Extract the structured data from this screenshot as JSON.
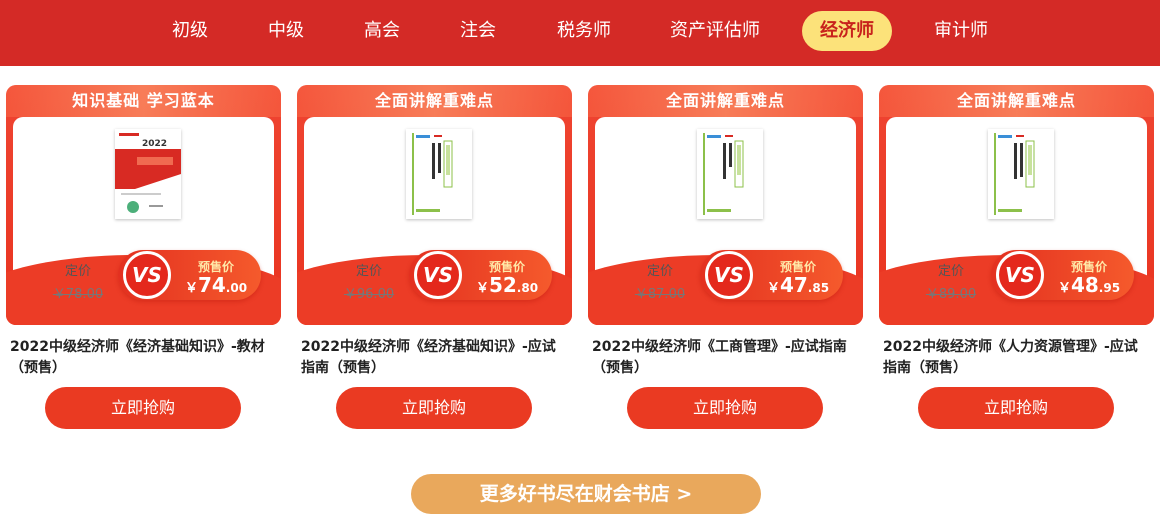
{
  "nav": {
    "tabs": [
      {
        "label": "初级"
      },
      {
        "label": "中级"
      },
      {
        "label": "高会"
      },
      {
        "label": "注会"
      },
      {
        "label": "税务师"
      },
      {
        "label": "资产评估师"
      },
      {
        "label": "经济师",
        "active": true
      },
      {
        "label": "审计师"
      }
    ]
  },
  "colors": {
    "nav_bg": "#d42a26",
    "active_tab_bg": "#fce27a",
    "card_red": "#ea3a22",
    "more_button_bg": "#e9a85c"
  },
  "products": [
    {
      "banner": "知识基础 学习蓝本",
      "list_price_label": "定价",
      "list_price": "￥78.00",
      "vs": "VS",
      "presale_label": "预售价",
      "presale_yen": "￥",
      "presale_int": "74",
      "presale_dec": ".00",
      "title": "2022中级经济师《经济基础知识》-教材（预售）",
      "buy_label": "立即抢购"
    },
    {
      "banner": "全面讲解重难点",
      "list_price_label": "定价",
      "list_price": "￥96.00",
      "vs": "VS",
      "presale_label": "预售价",
      "presale_yen": "￥",
      "presale_int": "52",
      "presale_dec": ".80",
      "title": "2022中级经济师《经济基础知识》-应试指南（预售）",
      "buy_label": "立即抢购"
    },
    {
      "banner": "全面讲解重难点",
      "list_price_label": "定价",
      "list_price": "￥87.00",
      "vs": "VS",
      "presale_label": "预售价",
      "presale_yen": "￥",
      "presale_int": "47",
      "presale_dec": ".85",
      "title": "2022中级经济师《工商管理》-应试指南（预售）",
      "buy_label": "立即抢购"
    },
    {
      "banner": "全面讲解重难点",
      "list_price_label": "定价",
      "list_price": "￥89.00",
      "vs": "VS",
      "presale_label": "预售价",
      "presale_yen": "￥",
      "presale_int": "48",
      "presale_dec": ".95",
      "title": "2022中级经济师《人力资源管理》-应试指南（预售）",
      "buy_label": "立即抢购"
    }
  ],
  "more_button": "更多好书尽在财会书店 >"
}
